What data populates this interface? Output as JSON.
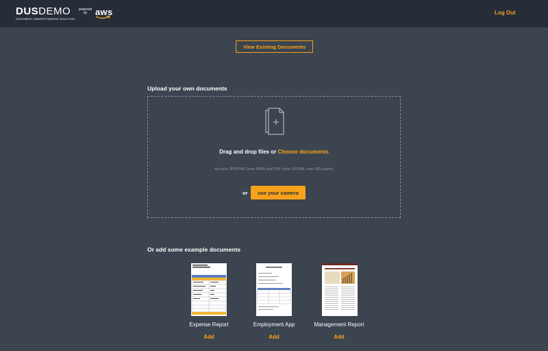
{
  "header": {
    "logo_dus": "DUS",
    "logo_demo": "DEMO",
    "logo_subtitle": "DOCUMENT UNDERSTANDING SOLUTION",
    "powered_line1": "powered",
    "powered_line2": "by",
    "aws_text": "aws",
    "logout_label": "Log Out"
  },
  "view_existing_label": "View Existing Documents",
  "upload": {
    "heading": "Upload your own documents",
    "drag_text": "Drag and drop files or ",
    "choose_link": "Choose documents",
    "accepts": "Accepts JPG/PNG (max 5MB) and PDF (max 150 MB, max 200 pages)",
    "or_label": "or",
    "camera_label": "use your camera"
  },
  "examples": {
    "heading": "Or add some example documents",
    "items": [
      {
        "label": "Expense Report",
        "add": "Add"
      },
      {
        "label": "Employment App",
        "add": "Add"
      },
      {
        "label": "Management Report",
        "add": "Add"
      }
    ]
  },
  "colors": {
    "accent": "#f7a21b",
    "background": "#3b444f",
    "header_bg": "#262d38"
  },
  "icons": [
    "file-upload-icon",
    "aws-smile-icon"
  ]
}
